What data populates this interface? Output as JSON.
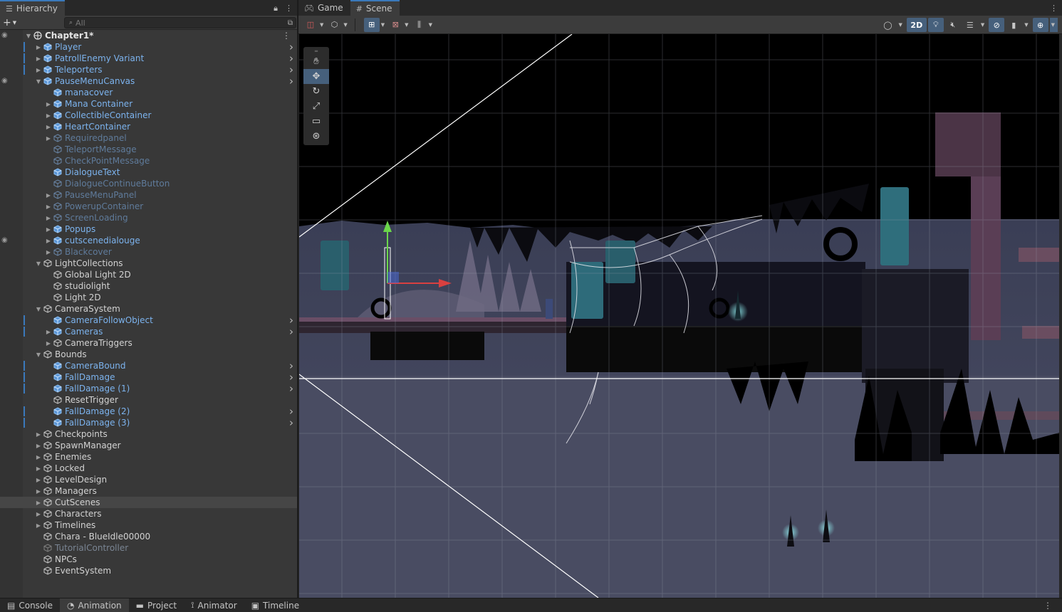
{
  "hierarchy": {
    "tab_label": "Hierarchy",
    "search_placeholder": "All",
    "rows": [
      {
        "label": "Chapter1*",
        "depth": 0,
        "fold": "open",
        "kind": "scene",
        "eye": true,
        "more": true
      },
      {
        "label": "Player",
        "depth": 1,
        "fold": "closed",
        "kind": "prefab",
        "chev": true,
        "mark": true
      },
      {
        "label": "PatrollEnemy Variant",
        "depth": 1,
        "fold": "closed",
        "kind": "prefab",
        "chev": true,
        "mark": true
      },
      {
        "label": "Teleporters",
        "depth": 1,
        "fold": "closed",
        "kind": "prefab",
        "chev": true,
        "mark": true
      },
      {
        "label": "PauseMenuCanvas",
        "depth": 1,
        "fold": "open",
        "kind": "prefab",
        "chev": true,
        "eye": true
      },
      {
        "label": "manacover",
        "depth": 2,
        "fold": "none",
        "kind": "prefab"
      },
      {
        "label": "Mana Container",
        "depth": 2,
        "fold": "closed",
        "kind": "prefab"
      },
      {
        "label": "CollectibleContainer",
        "depth": 2,
        "fold": "closed",
        "kind": "prefab"
      },
      {
        "label": "HeartContainer",
        "depth": 2,
        "fold": "closed",
        "kind": "prefab"
      },
      {
        "label": "Requiredpanel",
        "depth": 2,
        "fold": "closed",
        "kind": "inactive-prefab"
      },
      {
        "label": "TeleportMessage",
        "depth": 2,
        "fold": "none",
        "kind": "inactive-prefab"
      },
      {
        "label": "CheckPointMessage",
        "depth": 2,
        "fold": "none",
        "kind": "inactive-prefab"
      },
      {
        "label": "DialogueText",
        "depth": 2,
        "fold": "none",
        "kind": "prefab"
      },
      {
        "label": "DialogueContinueButton",
        "depth": 2,
        "fold": "none",
        "kind": "inactive-prefab"
      },
      {
        "label": "PauseMenuPanel",
        "depth": 2,
        "fold": "closed",
        "kind": "inactive-prefab"
      },
      {
        "label": "PowerupContainer",
        "depth": 2,
        "fold": "closed",
        "kind": "inactive-prefab"
      },
      {
        "label": "ScreenLoading",
        "depth": 2,
        "fold": "closed",
        "kind": "inactive-prefab"
      },
      {
        "label": "Popups",
        "depth": 2,
        "fold": "closed",
        "kind": "prefab"
      },
      {
        "label": "cutscenedialouge",
        "depth": 2,
        "fold": "closed",
        "kind": "prefab",
        "eye": true
      },
      {
        "label": "Blackcover",
        "depth": 2,
        "fold": "closed",
        "kind": "inactive-prefab"
      },
      {
        "label": "LightCollections",
        "depth": 1,
        "fold": "open",
        "kind": "normal"
      },
      {
        "label": "Global Light 2D",
        "depth": 2,
        "fold": "none",
        "kind": "normal"
      },
      {
        "label": "studiolight",
        "depth": 2,
        "fold": "none",
        "kind": "normal"
      },
      {
        "label": "Light 2D",
        "depth": 2,
        "fold": "none",
        "kind": "normal"
      },
      {
        "label": "CameraSystem",
        "depth": 1,
        "fold": "open",
        "kind": "normal"
      },
      {
        "label": "CameraFollowObject",
        "depth": 2,
        "fold": "none",
        "kind": "prefab",
        "chev": true,
        "mark": true
      },
      {
        "label": "Cameras",
        "depth": 2,
        "fold": "closed",
        "kind": "prefab",
        "chev": true,
        "mark": true
      },
      {
        "label": "CameraTriggers",
        "depth": 2,
        "fold": "closed",
        "kind": "normal"
      },
      {
        "label": "Bounds",
        "depth": 1,
        "fold": "open",
        "kind": "normal"
      },
      {
        "label": "CameraBound",
        "depth": 2,
        "fold": "none",
        "kind": "prefab",
        "chev": true,
        "mark": true
      },
      {
        "label": "FallDamage",
        "depth": 2,
        "fold": "none",
        "kind": "prefab",
        "chev": true,
        "mark": true
      },
      {
        "label": "FallDamage (1)",
        "depth": 2,
        "fold": "none",
        "kind": "prefab",
        "chev": true,
        "mark": true
      },
      {
        "label": "ResetTrigger",
        "depth": 2,
        "fold": "none",
        "kind": "normal"
      },
      {
        "label": "FallDamage (2)",
        "depth": 2,
        "fold": "none",
        "kind": "prefab",
        "chev": true,
        "mark": true
      },
      {
        "label": "FallDamage (3)",
        "depth": 2,
        "fold": "none",
        "kind": "prefab",
        "chev": true,
        "mark": true
      },
      {
        "label": "Checkpoints",
        "depth": 1,
        "fold": "closed",
        "kind": "normal"
      },
      {
        "label": "SpawnManager",
        "depth": 1,
        "fold": "closed",
        "kind": "normal"
      },
      {
        "label": "Enemies",
        "depth": 1,
        "fold": "closed",
        "kind": "normal"
      },
      {
        "label": "Locked",
        "depth": 1,
        "fold": "closed",
        "kind": "normal"
      },
      {
        "label": "LevelDesign",
        "depth": 1,
        "fold": "closed",
        "kind": "normal"
      },
      {
        "label": "Managers",
        "depth": 1,
        "fold": "closed",
        "kind": "normal"
      },
      {
        "label": "CutScenes",
        "depth": 1,
        "fold": "closed",
        "kind": "normal",
        "selected": true
      },
      {
        "label": "Characters",
        "depth": 1,
        "fold": "closed",
        "kind": "normal"
      },
      {
        "label": "Timelines",
        "depth": 1,
        "fold": "closed",
        "kind": "normal"
      },
      {
        "label": "Chara - BlueIdle00000",
        "depth": 1,
        "fold": "none",
        "kind": "normal"
      },
      {
        "label": "TutorialController",
        "depth": 1,
        "fold": "none",
        "kind": "inactive"
      },
      {
        "label": "NPCs",
        "depth": 1,
        "fold": "none",
        "kind": "normal"
      },
      {
        "label": "EventSystem",
        "depth": 1,
        "fold": "none",
        "kind": "normal"
      }
    ]
  },
  "scene_panel": {
    "tabs": [
      {
        "label": "Game",
        "icon": "gamepad-icon",
        "active": false
      },
      {
        "label": "Scene",
        "icon": "grid-icon",
        "active": true
      }
    ],
    "toolbar": {
      "mode_2d_label": "2D"
    },
    "tools": [
      "hand-tool",
      "move-tool",
      "rotate-tool",
      "scale-tool",
      "rect-tool",
      "transform-tool"
    ],
    "active_tool": "move-tool"
  },
  "bottom_tabs": [
    {
      "label": "Console",
      "icon": "console-icon",
      "active": false
    },
    {
      "label": "Animation",
      "icon": "animation-icon",
      "active": true
    },
    {
      "label": "Project",
      "icon": "folder-icon",
      "active": false
    },
    {
      "label": "Animator",
      "icon": "animator-icon",
      "active": false
    },
    {
      "label": "Timeline",
      "icon": "timeline-icon",
      "active": false
    }
  ],
  "colors": {
    "accent": "#3a79bb",
    "prefab_text": "#7cb3ee",
    "active_button": "#46607c"
  }
}
